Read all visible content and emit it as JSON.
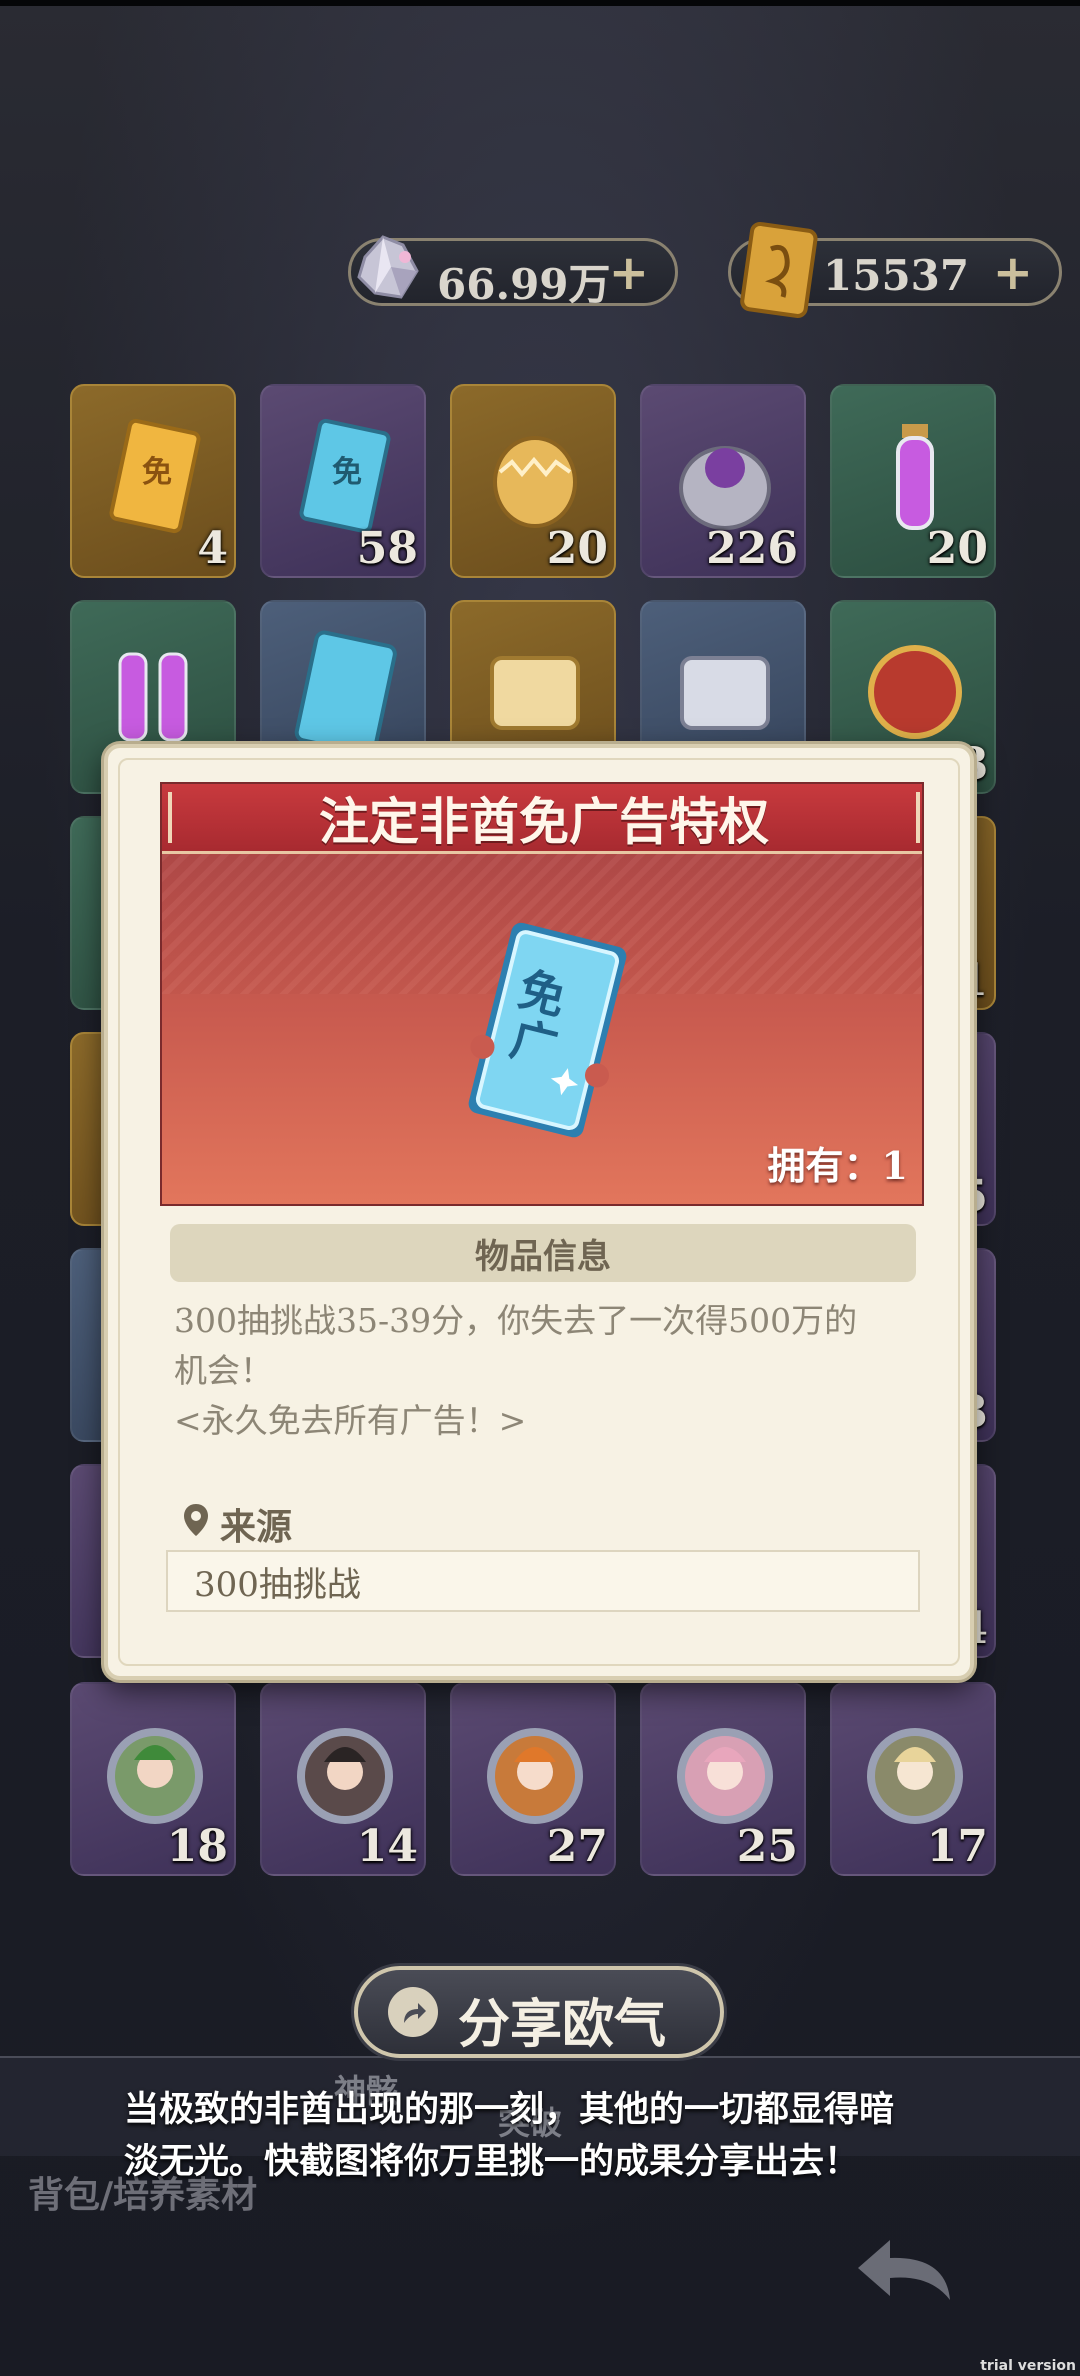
{
  "currencies": {
    "gems": {
      "value": "66.99万",
      "plus": "+",
      "icon": "crystal-icon"
    },
    "tickets": {
      "value": "15537",
      "plus": "+",
      "icon": "gold-ticket-icon"
    }
  },
  "inventory": {
    "row1": [
      "4",
      "58",
      "20",
      "226",
      "20"
    ],
    "row2_last": "8",
    "row3_last": "1",
    "row4_last": "5",
    "row5_last": "3",
    "row6_last": "4",
    "row7": [
      "18",
      "14",
      "27",
      "25",
      "17"
    ]
  },
  "modal": {
    "title": "注定非酋免广告特权",
    "item_icon": "ad-free-ticket-icon",
    "item_glyph": "免广",
    "owned": "拥有：1",
    "info_header": "物品信息",
    "desc_line1": "300抽挑战35-39分，你失去了一次得500万的",
    "desc_line2": "机会！",
    "desc_line3": "<永久免去所有广告！>",
    "source_label": "来源",
    "source_value": "300抽挑战"
  },
  "share": {
    "label": "分享欧气"
  },
  "caption": {
    "line1": "当极致的非酋出现的那一刻，其他的一切都显得暗",
    "line2": "淡无光。快截图将你万里挑一的成果分享出去！"
  },
  "nav": {
    "label": "背包/培养素材",
    "tab1": "神骸",
    "tab2": "突破"
  },
  "watermark": "trial version",
  "colors": {
    "modal_bg": "#f7f2e4",
    "banner_red": "#c83a3e",
    "hero_top": "#a84245",
    "hero_bottom": "#e2765c",
    "text_muted": "#8d8676"
  }
}
